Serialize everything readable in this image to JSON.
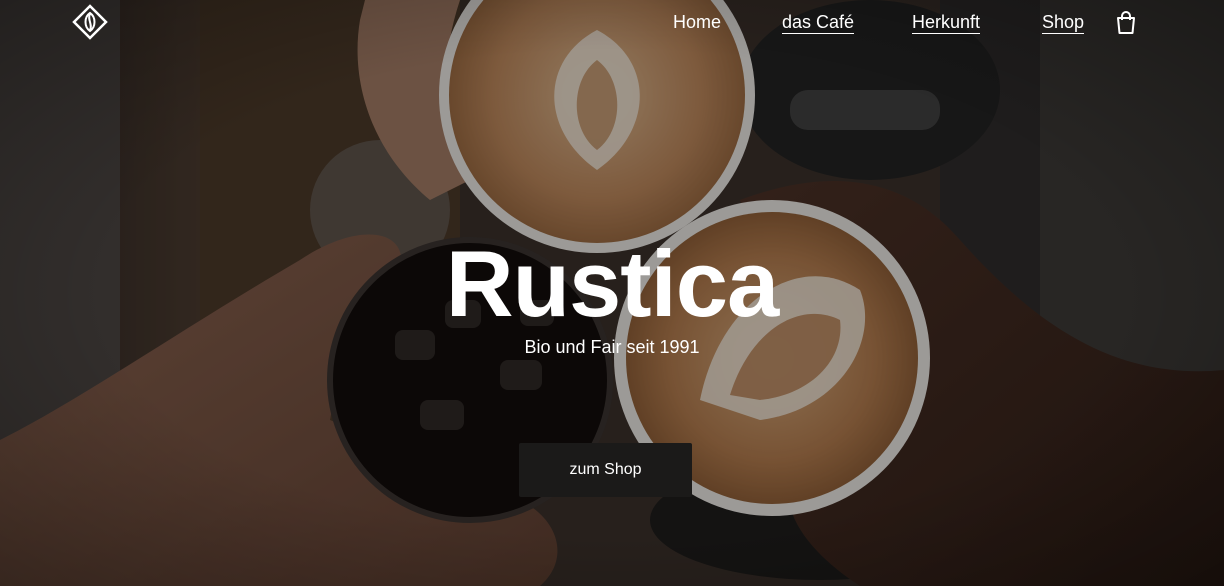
{
  "brand": {
    "logo_icon": "diamond-bean-logo-icon"
  },
  "nav": {
    "items": [
      {
        "label": "Home"
      },
      {
        "label": "das Café"
      },
      {
        "label": "Herkunft"
      },
      {
        "label": "Shop"
      }
    ],
    "cart_icon": "shopping-bag-icon"
  },
  "hero": {
    "title": "Rustica",
    "subtitle": "Bio und Fair seit 1991",
    "button_label": "zum Shop",
    "background_image": "coffee-cups-toast-photo"
  },
  "colors": {
    "text": "#ffffff",
    "button_bg": "#1b1a19"
  }
}
